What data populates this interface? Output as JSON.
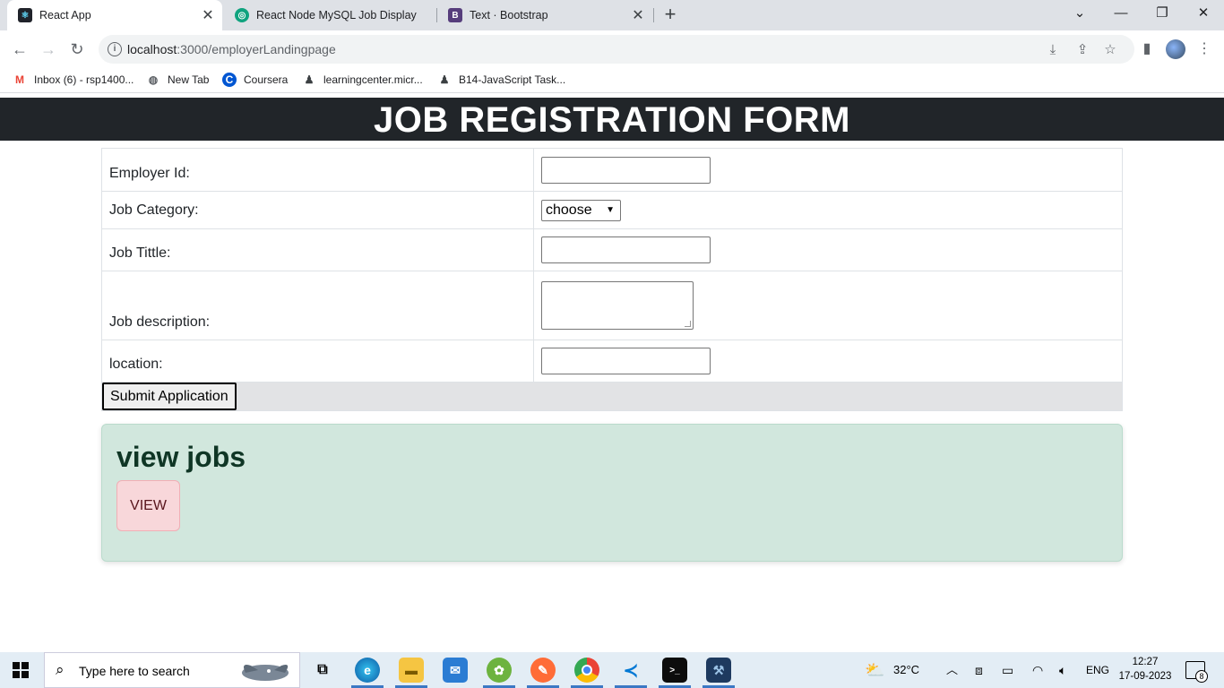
{
  "browser": {
    "tabs": [
      {
        "title": "React App",
        "active": true
      },
      {
        "title": "React Node MySQL Job Display",
        "active": false
      },
      {
        "title": "Text · Bootstrap",
        "active": false
      }
    ],
    "url_host": "localhost",
    "url_path": ":3000/employerLandingpage",
    "bookmarks": [
      {
        "label": "Inbox (6) - rsp1400...",
        "icon": "gmail-icon"
      },
      {
        "label": "New Tab",
        "icon": "globe-icon"
      },
      {
        "label": "Coursera",
        "icon": "coursera-icon"
      },
      {
        "label": "learningcenter.micr...",
        "icon": "user-icon"
      },
      {
        "label": "B14-JavaScript Task...",
        "icon": "user-icon"
      }
    ]
  },
  "page": {
    "header_title": "JOB REGISTRATION FORM",
    "form": {
      "employer_id_label": "Employer Id:",
      "employer_id_value": "",
      "job_category_label": "Job Category:",
      "job_category_selected": "choose",
      "job_title_label": "Job Tittle:",
      "job_title_value": "",
      "job_description_label": "Job description:",
      "job_description_value": "",
      "location_label": "location:",
      "location_value": "",
      "submit_label": "Submit Application"
    },
    "jobs_card": {
      "heading": "view jobs",
      "button_label": "VIEW"
    }
  },
  "taskbar": {
    "search_placeholder": "Type here to search",
    "weather_temp": "32°C",
    "language": "ENG",
    "time": "12:27",
    "date": "17-09-2023",
    "notification_count": "8"
  },
  "colors": {
    "header_bg": "#212529",
    "card_bg": "#d1e7dd",
    "view_btn_bg": "#f8d7da",
    "submit_row_bg": "#e2e3e5"
  }
}
